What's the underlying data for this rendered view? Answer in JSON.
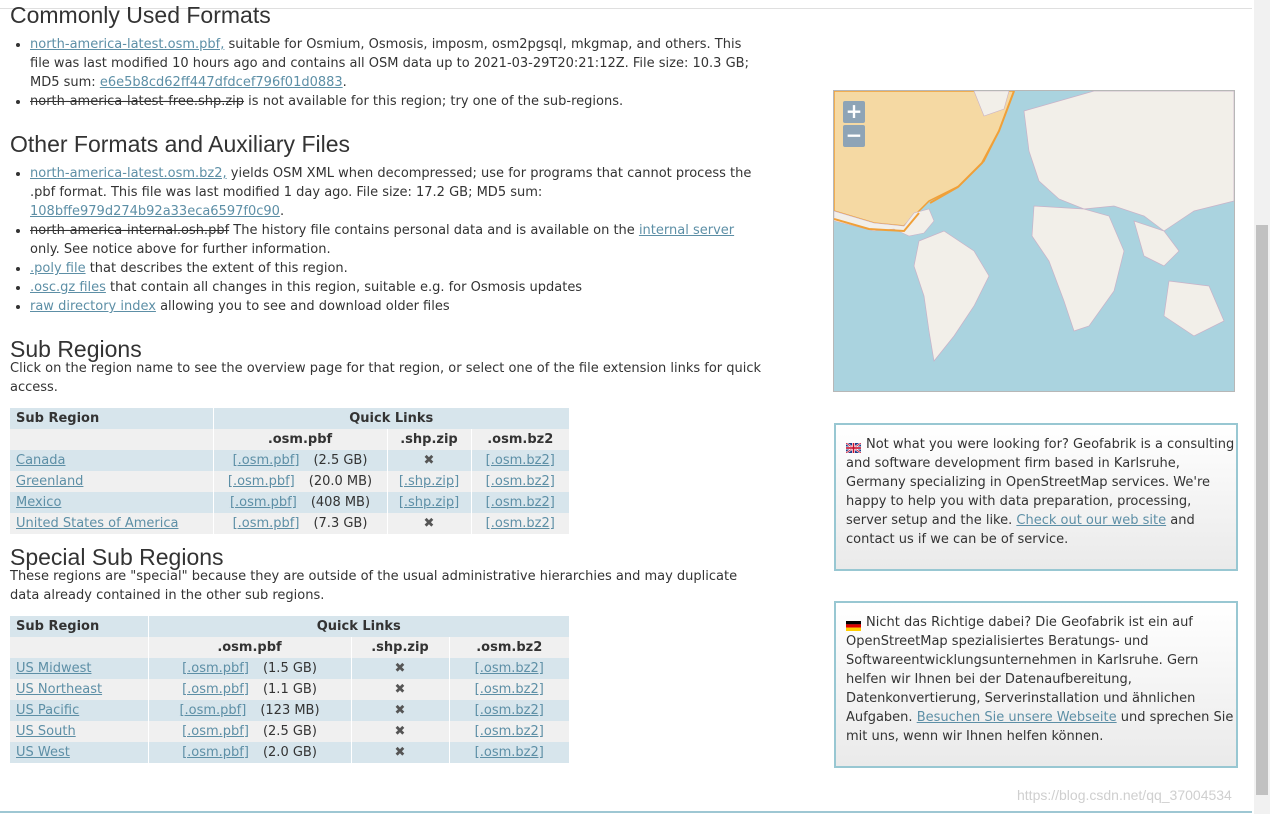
{
  "sections": {
    "common_title": "Commonly Used Formats",
    "other_title": "Other Formats and Auxiliary Files",
    "sub_title": "Sub Regions",
    "sub_intro": "Click on the region name to see the overview page for that region, or select one of the file extension links for quick access.",
    "special_title": "Special Sub Regions",
    "special_intro": "These regions are \"special\" because they are outside of the usual administrative hierarchies and may duplicate data already contained in the other sub regions."
  },
  "common": {
    "pbf_link": "north-america-latest.osm.pbf,",
    "pbf_text": " suitable for Osmium, Osmosis, imposm, osm2pgsql, mkgmap, and others. This file was last modified 10 hours ago and contains all OSM data up to 2021-03-29T20:21:12Z. File size: 10.3 GB; MD5 sum: ",
    "pbf_md5": "e6e5b8cd62ff447dfdcef796f01d0883",
    "pbf_end": ".",
    "shp_strike": "north-america-latest-free.shp.zip",
    "shp_text": " is not available for this region; try one of the sub-regions."
  },
  "other": {
    "bz2_link": "north-america-latest.osm.bz2,",
    "bz2_text": " yields OSM XML when decompressed; use for programs that cannot process the .pbf format. This file was last modified 1 day ago. File size: 17.2 GB; MD5 sum: ",
    "bz2_md5": "108bffe979d274b92a33eca6597f0c90",
    "bz2_end": ".",
    "internal_strike": "north-america-internal.osh.pbf",
    "internal_text": " The history file contains personal data and is available on the ",
    "internal_link": "internal server",
    "internal_end": " only. See notice above for further information.",
    "poly_link": ".poly file",
    "poly_text": " that describes the extent of this region.",
    "osc_link": ".osc.gz files",
    "osc_text": " that contain all changes in this region, suitable e.g. for Osmosis updates",
    "raw_link": "raw directory index",
    "raw_text": " allowing you to see and download older files"
  },
  "table_headers": {
    "sub_region": "Sub Region",
    "quick_links": "Quick Links",
    "pbf": ".osm.pbf",
    "shp": ".shp.zip",
    "bz2": ".osm.bz2"
  },
  "sub_regions": [
    {
      "name": "Canada",
      "pbf": "[.osm.pbf]",
      "size": "(2.5 GB)",
      "shp": "✖",
      "bz2": "[.osm.bz2]"
    },
    {
      "name": "Greenland",
      "pbf": "[.osm.pbf]",
      "size": "(20.0 MB)",
      "shp": "[.shp.zip]",
      "bz2": "[.osm.bz2]"
    },
    {
      "name": "Mexico",
      "pbf": "[.osm.pbf]",
      "size": "(408 MB)",
      "shp": "[.shp.zip]",
      "bz2": "[.osm.bz2]"
    },
    {
      "name": "United States of America",
      "pbf": "[.osm.pbf]",
      "size": "(7.3 GB)",
      "shp": "✖",
      "bz2": "[.osm.bz2]"
    }
  ],
  "special_regions": [
    {
      "name": "US Midwest",
      "pbf": "[.osm.pbf]",
      "size": "(1.5 GB)",
      "shp": "✖",
      "bz2": "[.osm.bz2]"
    },
    {
      "name": "US Northeast",
      "pbf": "[.osm.pbf]",
      "size": "(1.1 GB)",
      "shp": "✖",
      "bz2": "[.osm.bz2]"
    },
    {
      "name": "US Pacific",
      "pbf": "[.osm.pbf]",
      "size": "(123 MB)",
      "shp": "✖",
      "bz2": "[.osm.bz2]"
    },
    {
      "name": "US South",
      "pbf": "[.osm.pbf]",
      "size": "(2.5 GB)",
      "shp": "✖",
      "bz2": "[.osm.bz2]"
    },
    {
      "name": "US West",
      "pbf": "[.osm.pbf]",
      "size": "(2.0 GB)",
      "shp": "✖",
      "bz2": "[.osm.bz2]"
    }
  ],
  "map": {
    "zoom_in": "+",
    "zoom_out": "−"
  },
  "info_en": {
    "text": "Not what you were looking for? Geofabrik is a consulting and software development firm based in Karlsruhe, Germany specializing in OpenStreetMap services. We're happy to help you with data preparation, processing, server setup and the like. ",
    "link": "Check out our web site",
    "end": " and contact us if we can be of service."
  },
  "info_de": {
    "text": "Nicht das Richtige dabei? Die Geofabrik ist ein auf OpenStreetMap spezialisiertes Beratungs- und Softwareentwicklungsunternehmen in Karlsruhe. Gern helfen wir Ihnen bei der Datenaufbereitung, Datenkonvertierung, Serverinstallation und ähnlichen Aufgaben. ",
    "link": "Besuchen Sie unsere Webseite",
    "end": " und sprechen Sie mit uns, wenn wir Ihnen helfen können."
  },
  "watermark": "https://blog.csdn.net/qq_37004534"
}
